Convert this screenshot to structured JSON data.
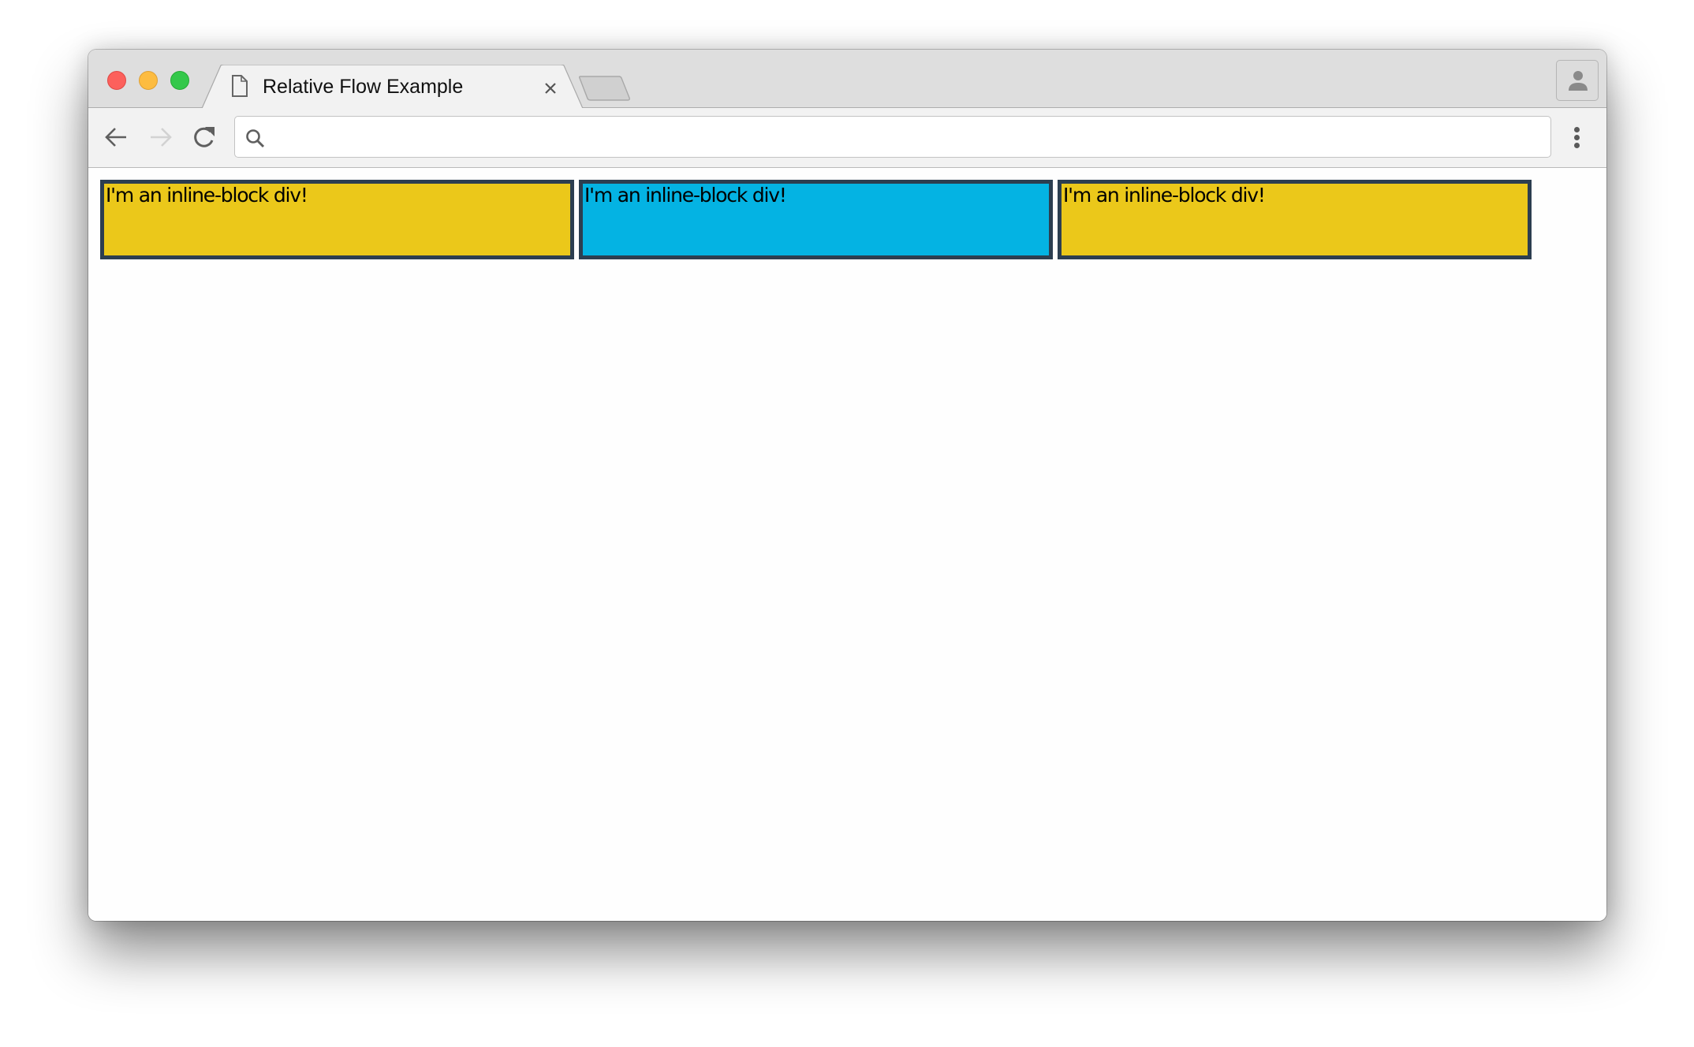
{
  "window": {
    "traffic_lights": [
      "close",
      "minimize",
      "zoom"
    ]
  },
  "tab": {
    "icon": "document-icon",
    "title": "Relative Flow Example",
    "close_icon": "close-icon"
  },
  "new_tab": {
    "icon": "new-tab-icon"
  },
  "profile": {
    "icon": "person-icon"
  },
  "toolbar": {
    "back_icon": "arrow-left-icon",
    "forward_icon": "arrow-right-icon",
    "forward_enabled": false,
    "reload_icon": "reload-icon",
    "menu_icon": "more-vertical-icon"
  },
  "omnibox": {
    "icon": "search-icon",
    "value": "",
    "placeholder": ""
  },
  "page": {
    "boxes": [
      {
        "text": "I'm an inline-block div!",
        "color": "#ebc81a"
      },
      {
        "text": "I'm an inline-block div!",
        "color": "#04b3e3"
      },
      {
        "text": "I'm an inline-block div!",
        "color": "#ebc81a"
      }
    ],
    "border_color": "#2c3e50"
  }
}
